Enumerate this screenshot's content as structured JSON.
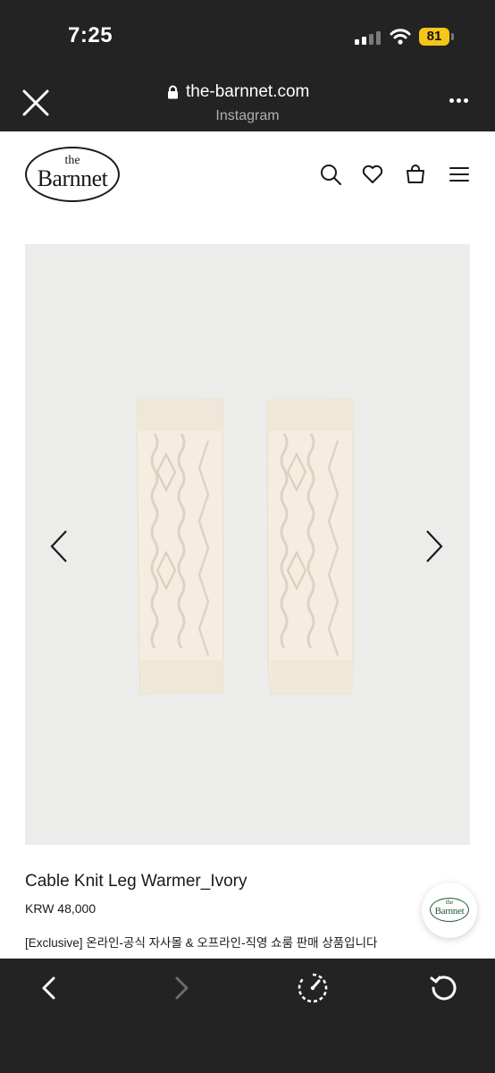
{
  "status_bar": {
    "time": "7:25",
    "battery": "81",
    "icons": [
      "cellular-signal-icon",
      "wifi-icon",
      "battery-icon"
    ]
  },
  "browser": {
    "url": "the-barnnet.com",
    "source": "Instagram",
    "icons": [
      "close-icon",
      "lock-icon",
      "more-icon"
    ]
  },
  "site": {
    "logo": {
      "the": "the",
      "name": "Barnnet"
    },
    "header_icons": [
      "search-icon",
      "heart-icon",
      "shopping-bag-icon",
      "menu-icon"
    ]
  },
  "product": {
    "title": "Cable Knit Leg Warmer_Ivory",
    "price": "KRW 48,000",
    "description": "[Exclusive] 온라인-공식 자사몰 & 오프라인-직영 쇼룸 판매 상품입니다",
    "image_background": "#ececea"
  },
  "floating_badge": {
    "the": "the",
    "name": "Barnnet"
  },
  "toolbar": {
    "icons": [
      "back-icon",
      "forward-icon",
      "speed-icon",
      "reload-icon"
    ],
    "forward_enabled": false
  },
  "colors": {
    "chrome": "#232323",
    "battery": "#f5c518",
    "badge_green": "#1e5a35"
  }
}
